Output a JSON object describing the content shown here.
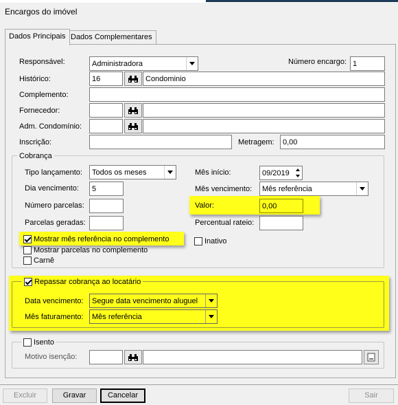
{
  "window": {
    "title": "Encargos do imóvel"
  },
  "tabs": [
    {
      "label": "Dados Principais"
    },
    {
      "label": "Dados Complementares"
    }
  ],
  "form": {
    "responsavel": {
      "label": "Responsável:",
      "value": "Administradora"
    },
    "numero_encargo": {
      "label": "Número encargo:",
      "value": "1"
    },
    "historico": {
      "label": "Histórico:",
      "code": "16",
      "desc": "Condominio"
    },
    "complemento": {
      "label": "Complemento:",
      "value": ""
    },
    "fornecedor": {
      "label": "Fornecedor:",
      "code": "",
      "desc": ""
    },
    "adm_condominio": {
      "label": "Adm. Condomínio:",
      "code": "",
      "desc": ""
    },
    "inscricao": {
      "label": "Inscrição:",
      "value": ""
    },
    "metragem": {
      "label": "Metragem:",
      "value": "0,00"
    }
  },
  "cobranca": {
    "legend": "Cobrança",
    "tipo_lancamento": {
      "label": "Tipo lançamento:",
      "value": "Todos os meses"
    },
    "dia_vencimento": {
      "label": "Dia vencimento:",
      "value": "5"
    },
    "numero_parcelas": {
      "label": "Número parcelas:",
      "value": ""
    },
    "parcelas_geradas": {
      "label": "Parcelas geradas:",
      "value": ""
    },
    "mes_inicio": {
      "label": "Mês início:",
      "value": "09/2019"
    },
    "mes_vencimento": {
      "label": "Mês vencimento:",
      "value": "Mês referência"
    },
    "valor": {
      "label": "Valor:",
      "value": "0,00"
    },
    "percentual_rateio": {
      "label": "Percentual rateio:",
      "value": ""
    },
    "chk_mostrar_mes": {
      "label": "Mostrar mês referência no complemento",
      "checked": true
    },
    "chk_inativo": {
      "label": "Inativo",
      "checked": false
    },
    "chk_mostrar_parcelas": {
      "label": "Mostrar parcelas no complemento",
      "checked": false
    },
    "chk_carne": {
      "label": "Carnê",
      "checked": false
    }
  },
  "repasse": {
    "legend": "Repassar cobrança ao locatário",
    "checked": true,
    "data_vencimento": {
      "label": "Data vencimento:",
      "value": "Segue data vencimento aluguel"
    },
    "mes_faturamento": {
      "label": "Mês faturamento:",
      "value": "Mês referência"
    }
  },
  "isento": {
    "legend": "Isento",
    "checked": false,
    "motivo": {
      "label": "Motivo isenção:",
      "code": "",
      "desc": ""
    }
  },
  "buttons": {
    "excluir": "Excluir",
    "gravar": "Gravar",
    "cancelar": "Cancelar",
    "sair": "Sair"
  },
  "colors": {
    "highlight": "#ffff1a",
    "accent": "#1f3a57"
  }
}
